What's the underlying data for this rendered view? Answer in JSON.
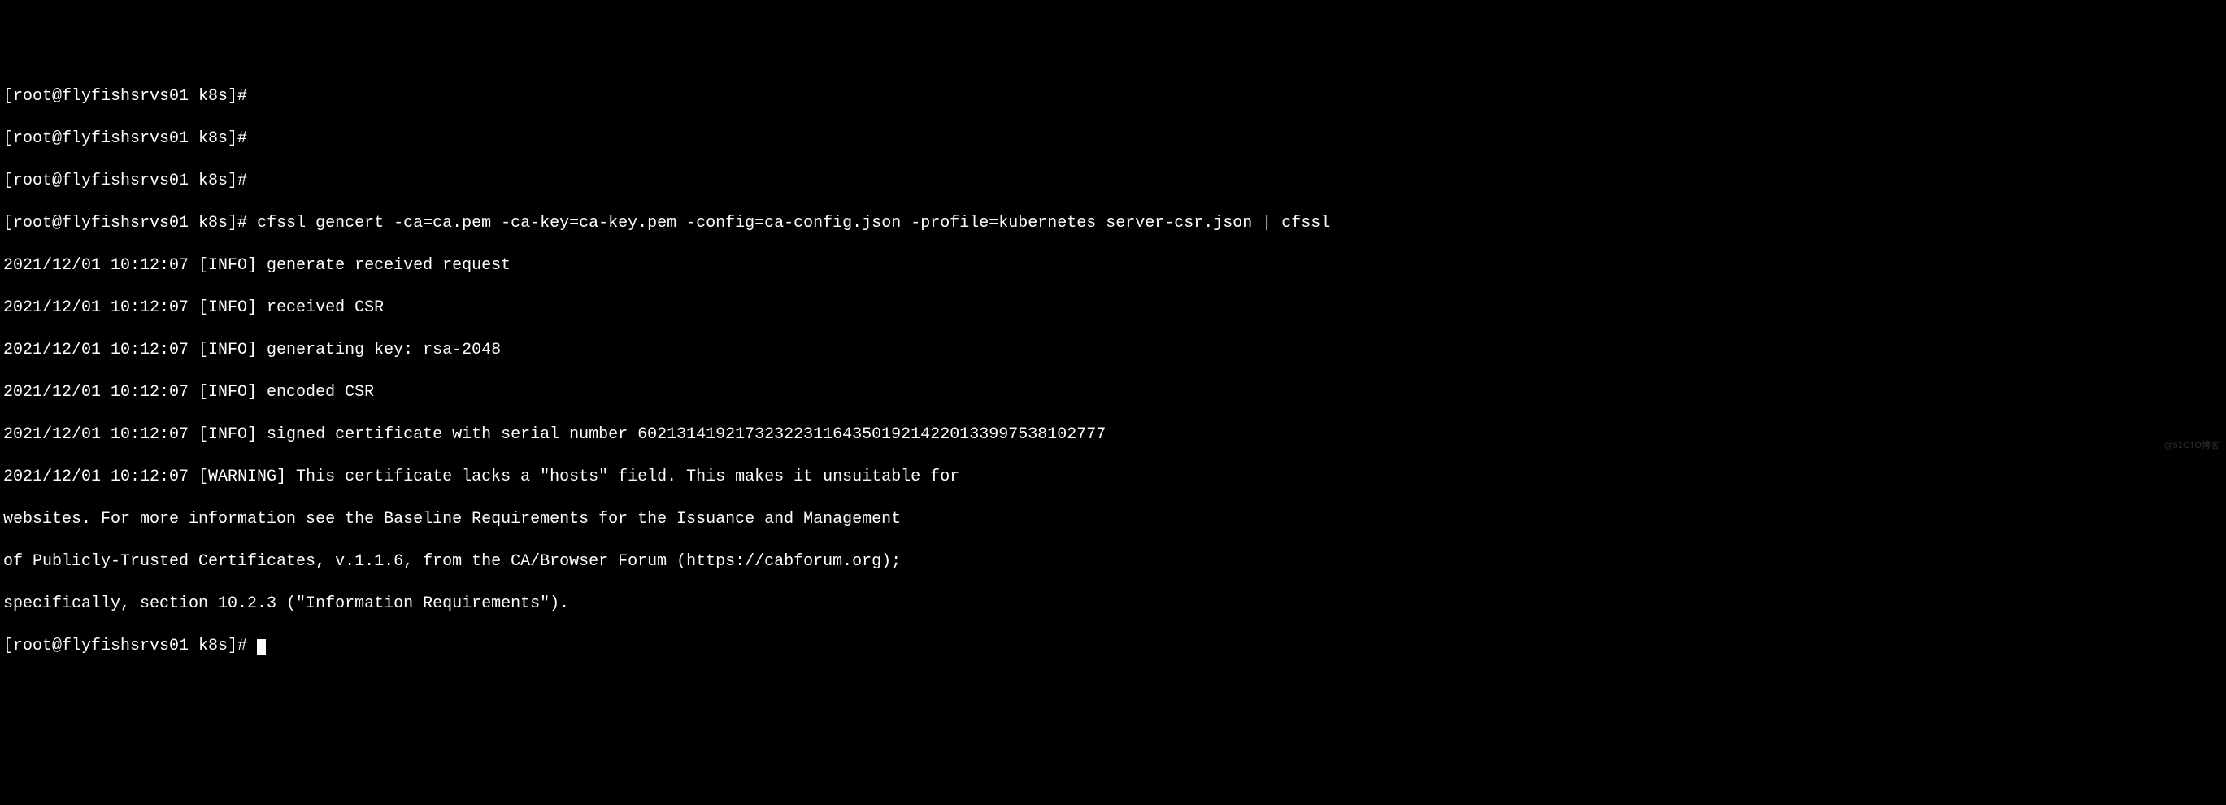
{
  "lines": {
    "l0_prompt_partial": "[root@flyfishsrvs01 k8s]#",
    "l1_prompt": "[root@flyfishsrvs01 k8s]#",
    "l2_prompt": "[root@flyfishsrvs01 k8s]#",
    "l3_prompt": "[root@flyfishsrvs01 k8s]# ",
    "l3_command": "cfssl gencert -ca=ca.pem -ca-key=ca-key.pem -config=ca-config.json -profile=kubernetes server-csr.json | cfssl",
    "l4": "2021/12/01 10:12:07 [INFO] generate received request",
    "l5": "2021/12/01 10:12:07 [INFO] received CSR",
    "l6": "2021/12/01 10:12:07 [INFO] generating key: rsa-2048",
    "l7": "2021/12/01 10:12:07 [INFO] encoded CSR",
    "l8": "2021/12/01 10:12:07 [INFO] signed certificate with serial number 602131419217323223116435019214220133997538102777",
    "l9": "2021/12/01 10:12:07 [WARNING] This certificate lacks a \"hosts\" field. This makes it unsuitable for",
    "l10": "websites. For more information see the Baseline Requirements for the Issuance and Management",
    "l11": "of Publicly-Trusted Certificates, v.1.1.6, from the CA/Browser Forum (https://cabforum.org);",
    "l12": "specifically, section 10.2.3 (\"Information Requirements\").",
    "l13_prompt": "[root@flyfishsrvs01 k8s]# "
  },
  "watermark": "@51CTO博客"
}
